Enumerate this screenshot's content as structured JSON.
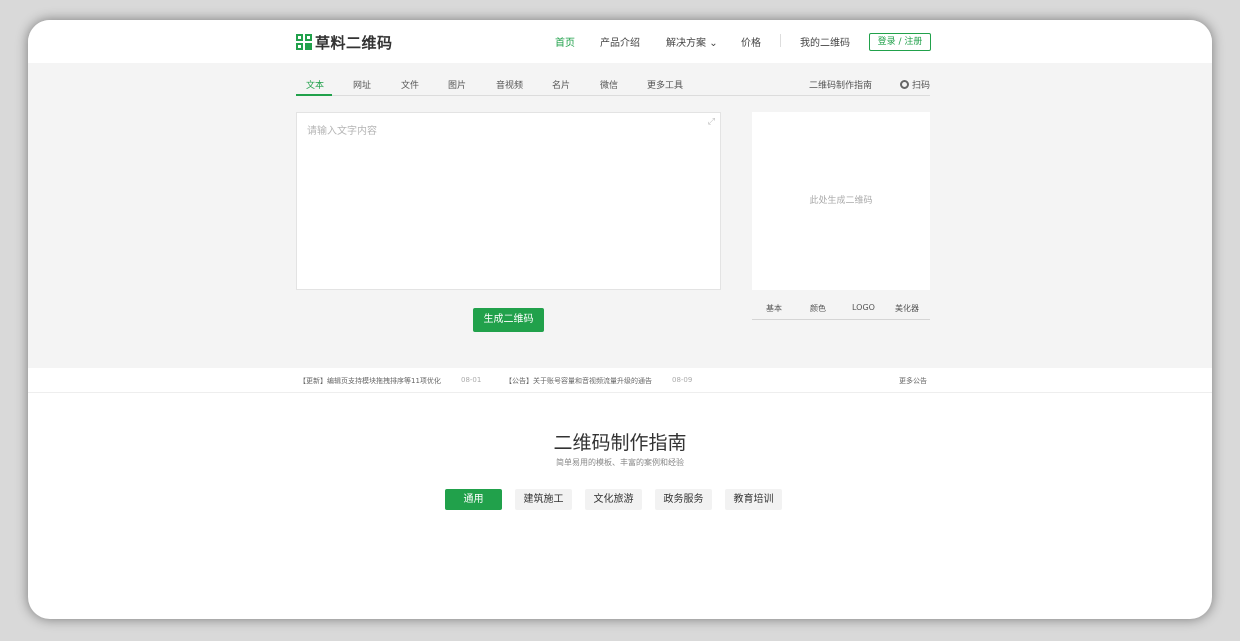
{
  "brand": {
    "name": "草料二维码",
    "accent": "#21a14b"
  },
  "nav": {
    "home": "首页",
    "products": "产品介绍",
    "solutions": "解决方案",
    "solutions_chevron": "⌄",
    "pricing": "价格",
    "my_qr": "我的二维码",
    "login": "登录 / 注册"
  },
  "tabs": [
    "文本",
    "网址",
    "文件",
    "图片",
    "音视频",
    "名片",
    "微信",
    "更多工具"
  ],
  "tabs_right": {
    "guide": "二维码制作指南",
    "scan": "扫码"
  },
  "editor": {
    "placeholder": "请输入文字内容",
    "expand_icon": "⤢"
  },
  "generate_button": "生成二维码",
  "qr_placeholder": "此处生成二维码",
  "style_tabs": [
    "基本",
    "颜色",
    "LOGO",
    "美化器"
  ],
  "notices": [
    {
      "text": "【更新】编辑页支持模块拖拽排序等11项优化",
      "date": "08-01"
    },
    {
      "text": "【公告】关于账号容量和音视频流量升级的通告",
      "date": "08-09"
    }
  ],
  "more_notices": "更多公告",
  "guide": {
    "title": "二维码制作指南",
    "subtitle": "简单易用的模板、丰富的案例和经验",
    "categories": [
      "通用",
      "建筑施工",
      "文化旅游",
      "政务服务",
      "教育培训"
    ]
  }
}
